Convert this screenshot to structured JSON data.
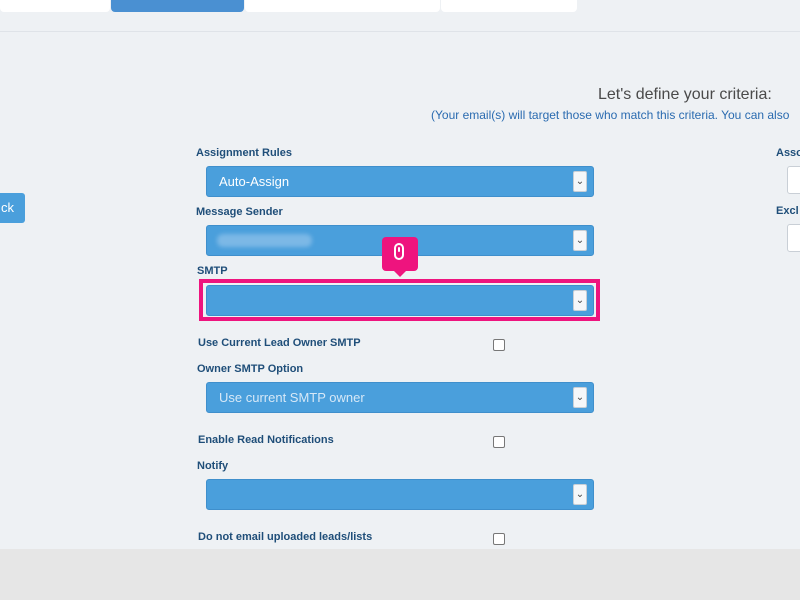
{
  "criteria": {
    "title": "Let's define your criteria:",
    "subtitle": "(Your email(s) will target those who match this criteria. You can also"
  },
  "back_button": {
    "label": "ck"
  },
  "form": {
    "assignment_rules": {
      "label": "Assignment Rules",
      "value": "Auto-Assign"
    },
    "message_sender": {
      "label": "Message Sender",
      "value": ""
    },
    "smtp": {
      "label": "SMTP",
      "value": ""
    },
    "use_current_owner_smtp": {
      "label": "Use Current Lead Owner SMTP",
      "checked": false
    },
    "owner_smtp_option": {
      "label": "Owner SMTP Option",
      "placeholder": "Use current SMTP owner"
    },
    "enable_read_notifications": {
      "label": "Enable Read Notifications",
      "checked": false
    },
    "notify": {
      "label": "Notify",
      "value": ""
    },
    "do_not_email_uploaded": {
      "label": "Do not email uploaded leads/lists",
      "checked": false
    }
  },
  "right_panel": {
    "label_1": "Asso",
    "label_2": "Excl"
  },
  "icons": {
    "dropdown": "chevron-down-icon",
    "cursor": "mouse-icon"
  },
  "colors": {
    "accent": "#4a9fdc",
    "highlight": "#ee147e",
    "label": "#1f4e79",
    "subtitle": "#2a6bb0"
  }
}
